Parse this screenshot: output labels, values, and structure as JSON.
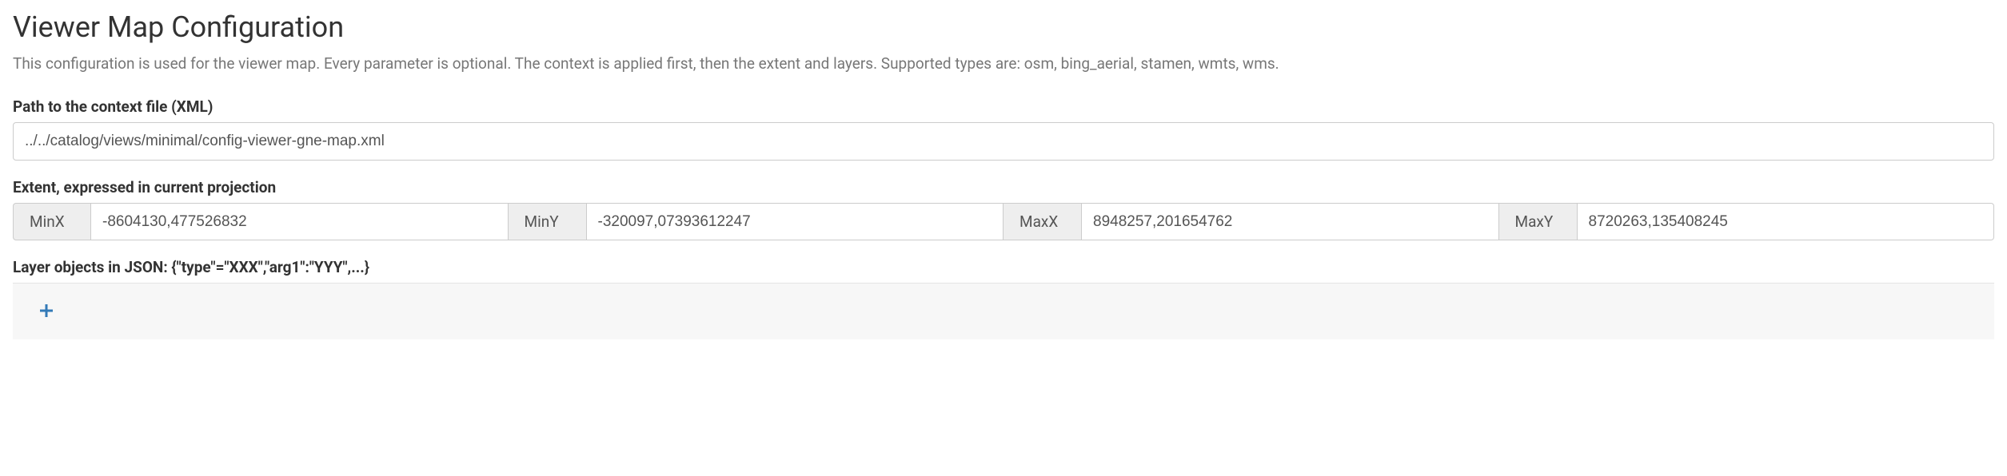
{
  "header": {
    "title": "Viewer Map Configuration",
    "description": "This configuration is used for the viewer map. Every parameter is optional. The context is applied first, then the extent and layers. Supported types are: osm, bing_aerial, stamen, wmts, wms."
  },
  "contextFile": {
    "label": "Path to the context file (XML)",
    "value": "../../catalog/views/minimal/config-viewer-gne-map.xml"
  },
  "extent": {
    "label": "Extent, expressed in current projection",
    "minx": {
      "label": "MinX",
      "value": "-8604130,477526832"
    },
    "miny": {
      "label": "MinY",
      "value": "-320097,07393612247"
    },
    "maxx": {
      "label": "MaxX",
      "value": "8948257,201654762"
    },
    "maxy": {
      "label": "MaxY",
      "value": "8720263,135408245"
    }
  },
  "layers": {
    "label": "Layer objects in JSON: {\"type\"=\"XXX\",\"arg1\":\"YYY\",...}"
  }
}
